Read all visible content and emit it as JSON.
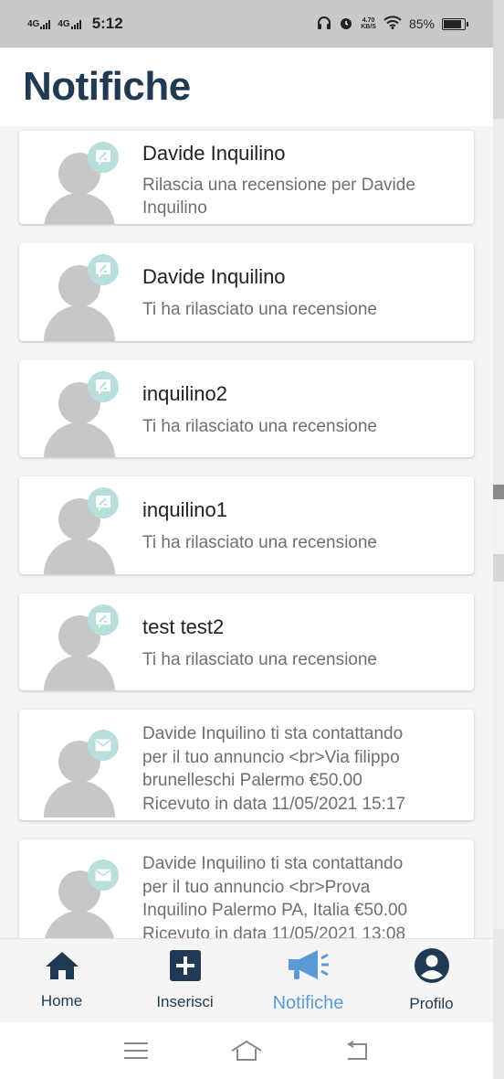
{
  "status_bar": {
    "network1": "4G",
    "network2": "4G",
    "time": "5:12",
    "speed_value": "4.70",
    "speed_unit": "KB/S",
    "battery": "85%",
    "battery_level": 0.85
  },
  "header": {
    "title": "Notifiche"
  },
  "notifications": [
    {
      "type": "review",
      "name": "Davide Inquilino",
      "text": "Rilascia una recensione per Davide Inquilino"
    },
    {
      "type": "review",
      "name": "Davide Inquilino",
      "text": "Ti ha rilasciato una recensione"
    },
    {
      "type": "review",
      "name": "inquilino2",
      "text": "Ti ha rilasciato una recensione"
    },
    {
      "type": "review",
      "name": "inquilino1",
      "text": "Ti ha rilasciato una recensione"
    },
    {
      "type": "review",
      "name": "test test2",
      "text": "Ti ha rilasciato una recensione"
    },
    {
      "type": "message",
      "lines": [
        "Davide Inquilino  ti sta contattando",
        "per il tuo annuncio <br>Via filippo",
        "brunelleschi Palermo  €50.00",
        "Ricevuto in data 11/05/2021 15:17"
      ]
    },
    {
      "type": "message",
      "lines": [
        "Davide Inquilino  ti sta contattando",
        "per il tuo annuncio <br>Prova",
        "Inquilino  Palermo PA, Italia  €50.00",
        "Ricevuto in data 11/05/2021 13:08"
      ]
    }
  ],
  "bottom_nav": {
    "items": [
      {
        "label": "Home",
        "icon": "home-icon"
      },
      {
        "label": "Inserisci",
        "icon": "add-box-icon"
      },
      {
        "label": "Notifiche",
        "icon": "megaphone-icon",
        "active": true
      },
      {
        "label": "Profilo",
        "icon": "account-circle-icon"
      }
    ]
  },
  "colors": {
    "primary": "#1f3a52",
    "active": "#5b9bd5",
    "badge": "#b9dfdd",
    "avatar": "#c7c7c7"
  }
}
